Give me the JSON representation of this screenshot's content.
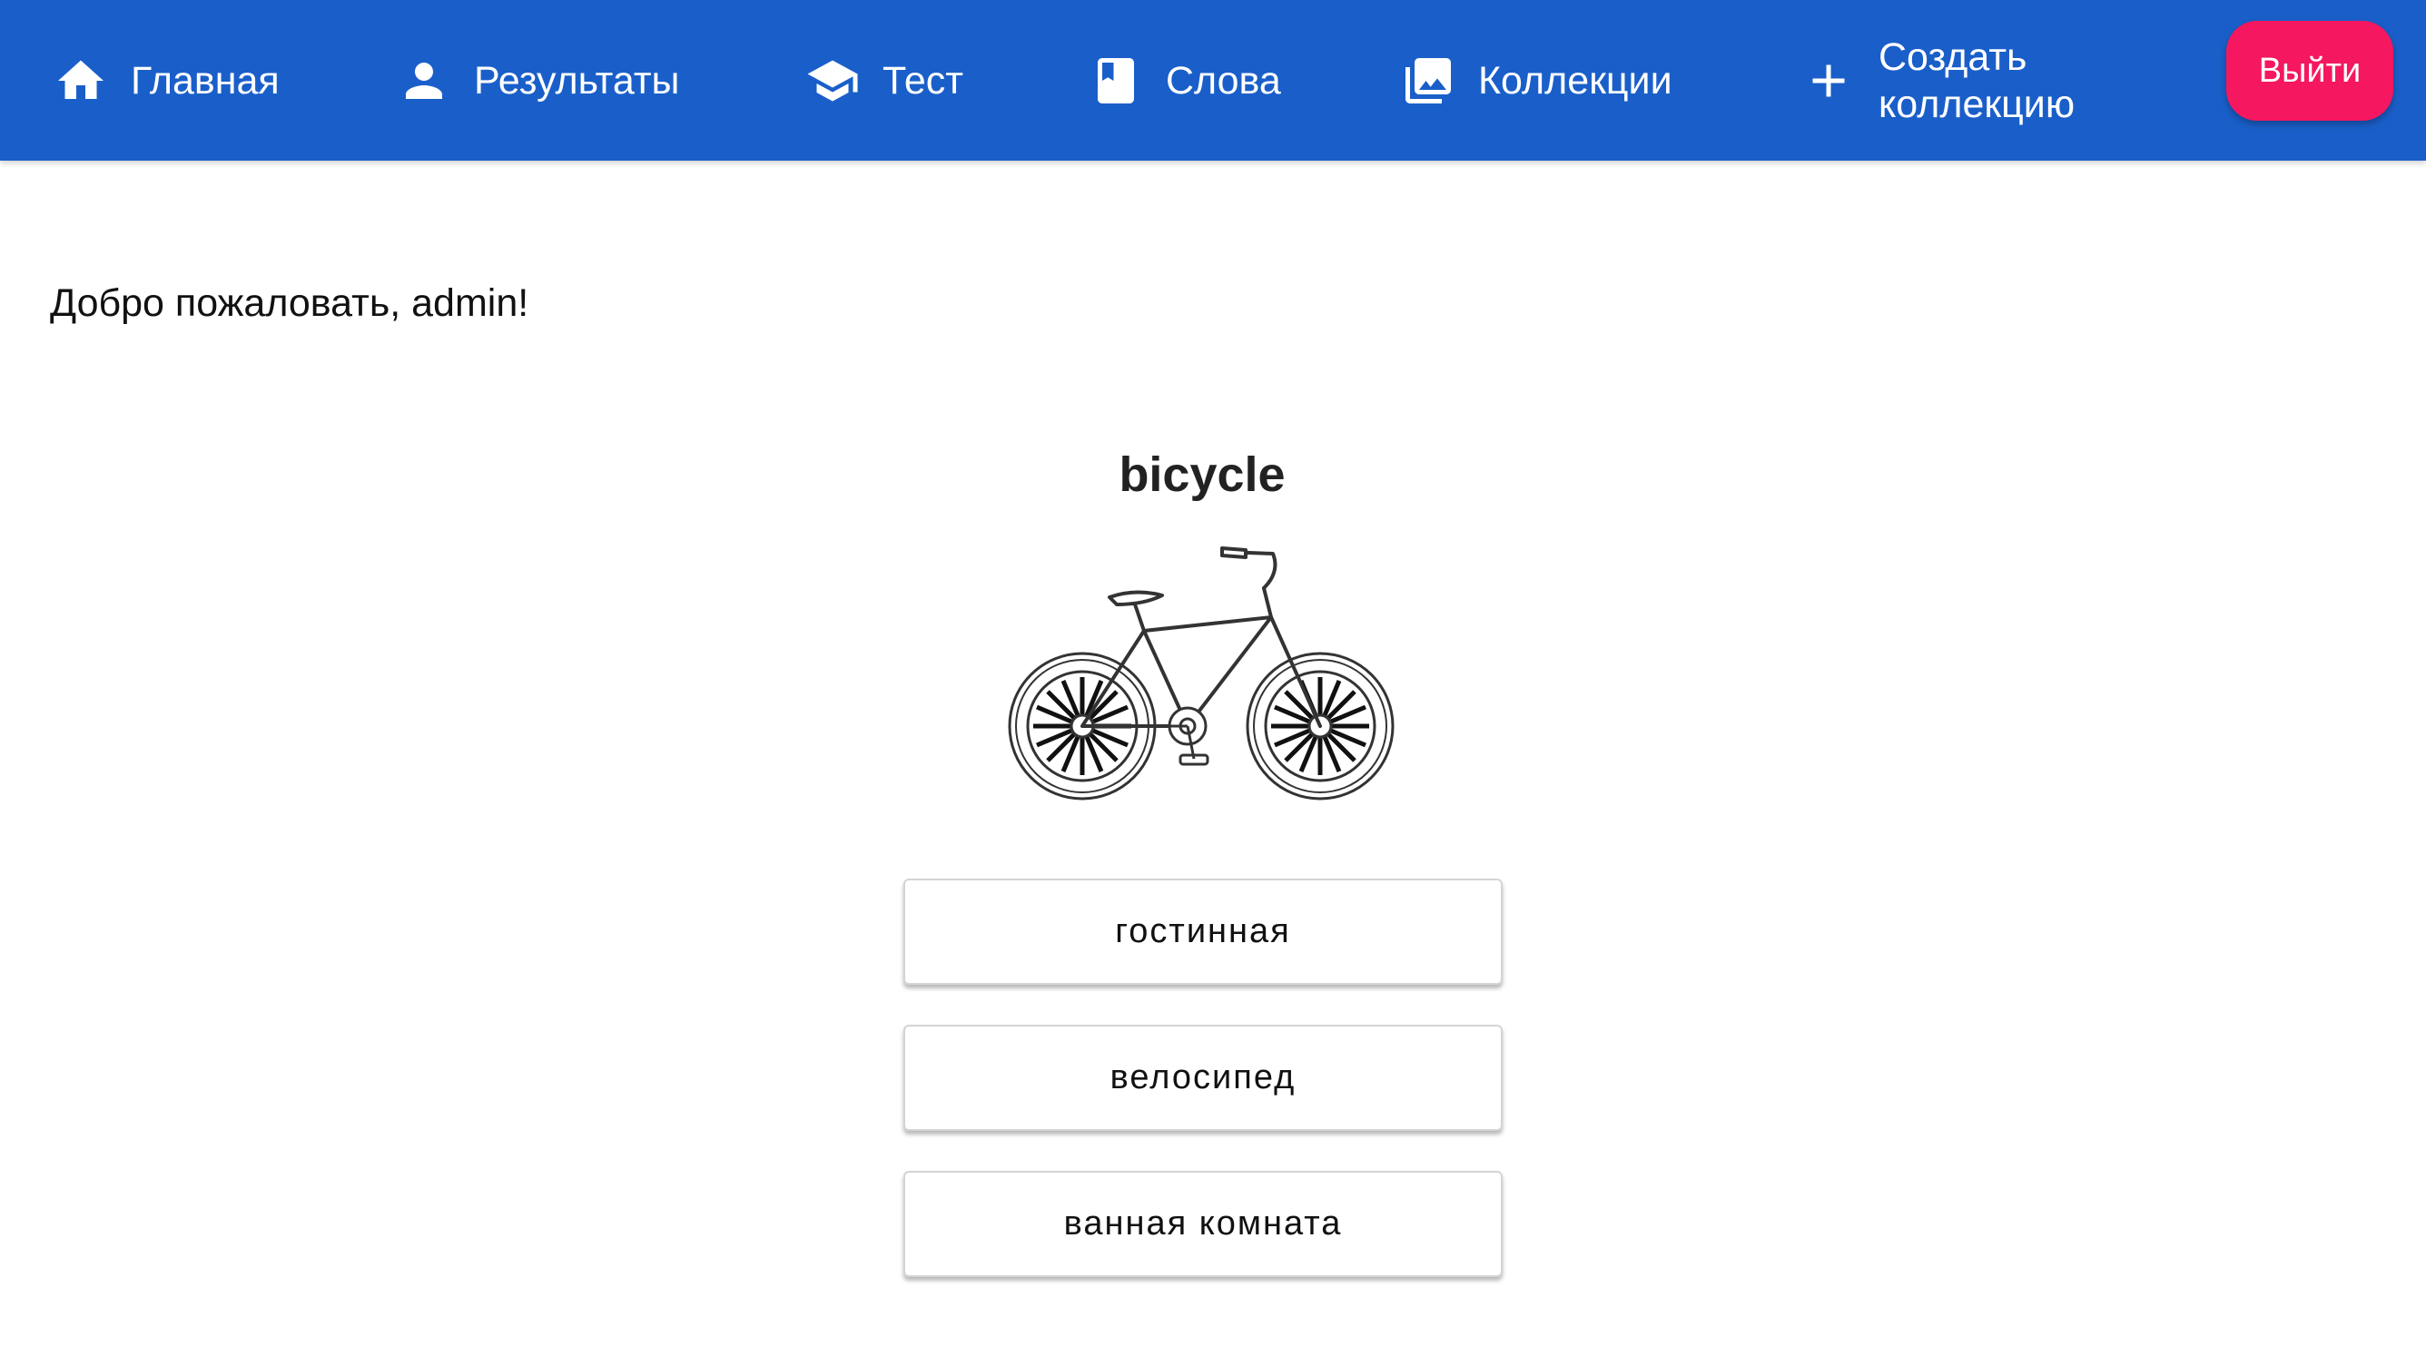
{
  "nav": {
    "items": [
      {
        "label": "Главная",
        "icon": "home-icon"
      },
      {
        "label": "Результаты",
        "icon": "person-icon"
      },
      {
        "label": "Тест",
        "icon": "graduation-cap-icon"
      },
      {
        "label": "Слова",
        "icon": "book-icon"
      },
      {
        "label": "Коллекции",
        "icon": "photo-library-icon"
      },
      {
        "label": "Создать коллекцию",
        "icon": "plus-icon"
      }
    ],
    "logout_label": "Выйти"
  },
  "welcome_text": "Добро пожаловать, admin!",
  "quiz": {
    "word": "bicycle",
    "image": "bicycle-illustration",
    "options": [
      "гостинная",
      "велосипед",
      "ванная комната"
    ]
  },
  "colors": {
    "header": "#1a5fc9",
    "logout": "#f5175f"
  }
}
